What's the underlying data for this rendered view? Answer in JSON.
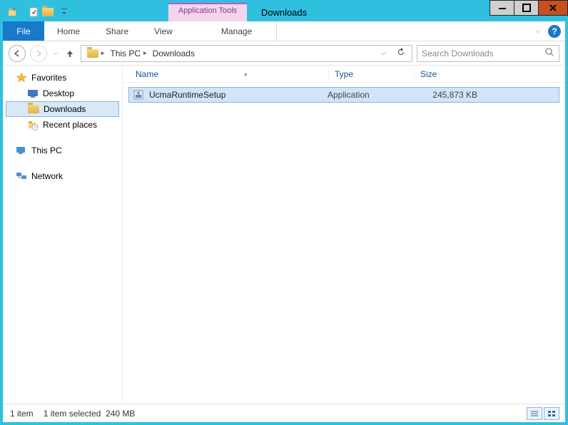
{
  "window": {
    "title": "Downloads",
    "contextual_tab": "Application Tools"
  },
  "ribbon": {
    "file": "File",
    "home": "Home",
    "share": "Share",
    "view": "View",
    "manage": "Manage"
  },
  "address": {
    "root": "This PC",
    "current": "Downloads"
  },
  "search": {
    "placeholder": "Search Downloads"
  },
  "nav": {
    "favorites": "Favorites",
    "desktop": "Desktop",
    "downloads": "Downloads",
    "recent": "Recent places",
    "thispc": "This PC",
    "network": "Network"
  },
  "columns": {
    "name": "Name",
    "type": "Type",
    "size": "Size"
  },
  "files": [
    {
      "name": "UcmaRuntimeSetup",
      "type": "Application",
      "size": "245,873 KB"
    }
  ],
  "status": {
    "count": "1 item",
    "selected": "1 item selected",
    "selsize": "240 MB"
  }
}
